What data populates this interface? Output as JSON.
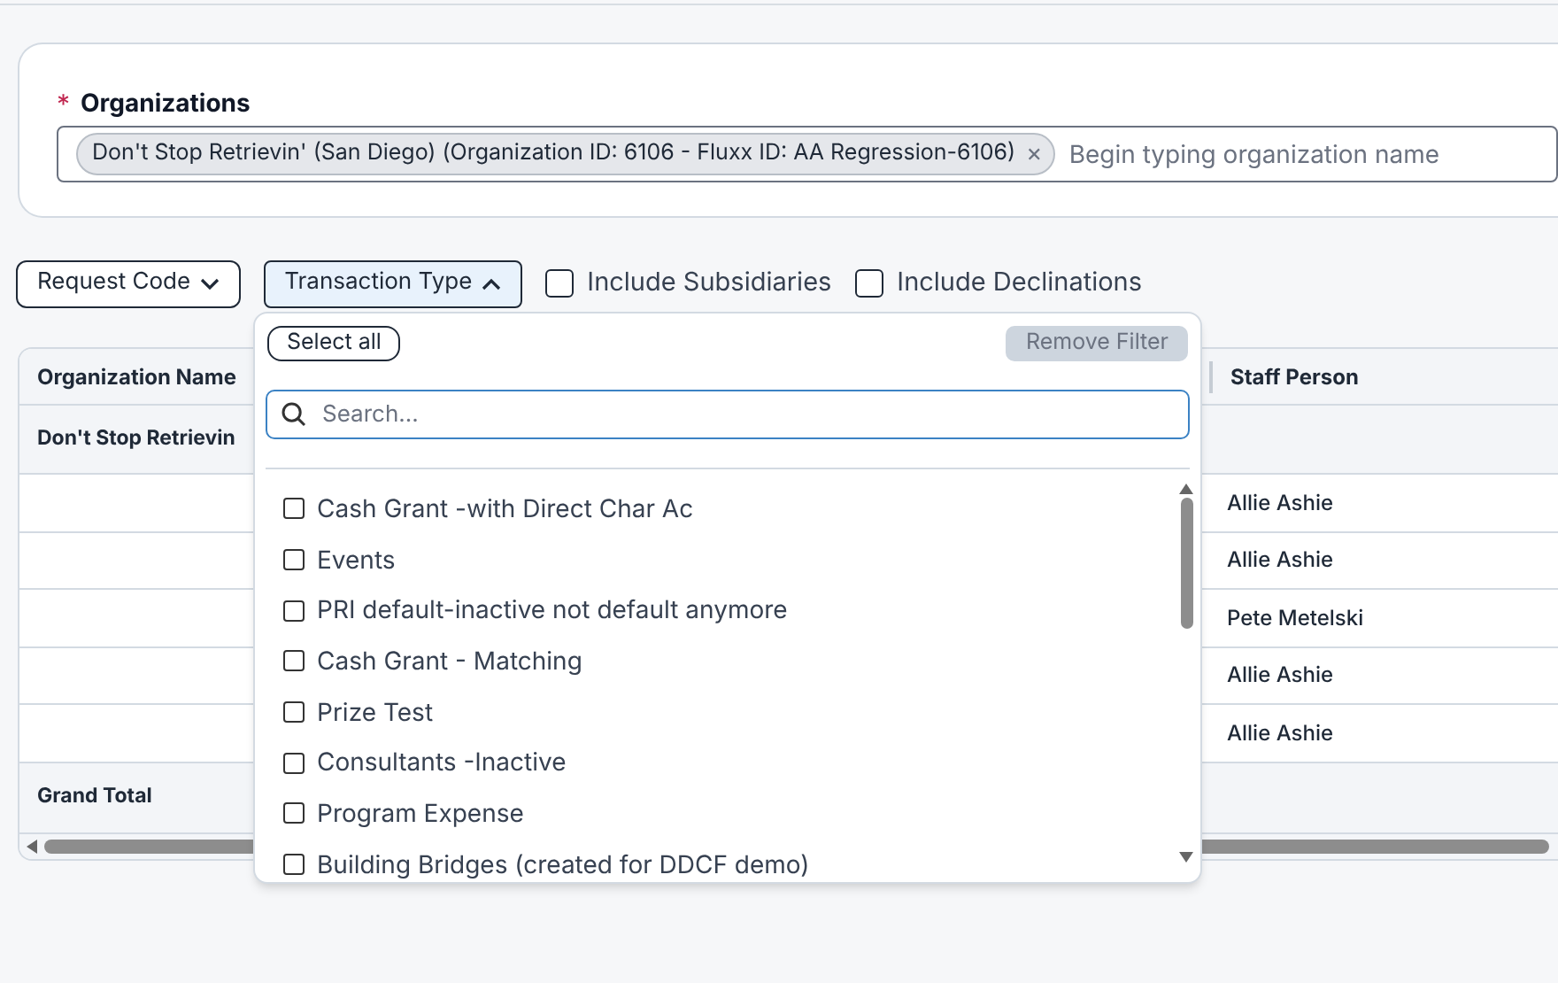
{
  "organizations": {
    "label": "Organizations",
    "required_mark": "*",
    "tags": [
      {
        "label": "Don't Stop Retrievin' (San Diego) (Organization ID: 6106 - Fluxx ID: AA Regression-6106)",
        "remove": "×"
      }
    ],
    "placeholder": "Begin typing organization name"
  },
  "filters": [
    {
      "kind": "dropdown",
      "label": "Request Code",
      "expanded": false
    },
    {
      "kind": "dropdown",
      "label": "Transaction Type",
      "expanded": true
    },
    {
      "kind": "checkbox",
      "label": "Include Subsidiaries",
      "checked": false
    },
    {
      "kind": "checkbox",
      "label": "Include Declinations",
      "checked": false
    }
  ],
  "dropdown": {
    "select_all": "Select all",
    "remove_filter": "Remove Filter",
    "search_placeholder": "Search...",
    "options": [
      {
        "label": "Cash Grant -with Direct Char Ac",
        "checked": false
      },
      {
        "label": "Events",
        "checked": false
      },
      {
        "label": "PRI default-inactive not default anymore",
        "checked": false
      },
      {
        "label": "Cash Grant - Matching",
        "checked": false
      },
      {
        "label": "Prize Test",
        "checked": false
      },
      {
        "label": "Consultants -Inactive",
        "checked": false
      },
      {
        "label": "Program Expense",
        "checked": false
      },
      {
        "label": "Building Bridges (created for DDCF demo)",
        "checked": false
      }
    ]
  },
  "table": {
    "columns": [
      "Organization Name",
      "Staff Person"
    ],
    "group_row": "Don't Stop Retrievin",
    "rows": [
      [
        "",
        "Allie Ashie"
      ],
      [
        "",
        "Allie Ashie"
      ],
      [
        "",
        "Pete Metelski"
      ],
      [
        "",
        "Allie Ashie"
      ],
      [
        "",
        "Allie Ashie"
      ]
    ],
    "total_row": "Grand Total"
  }
}
